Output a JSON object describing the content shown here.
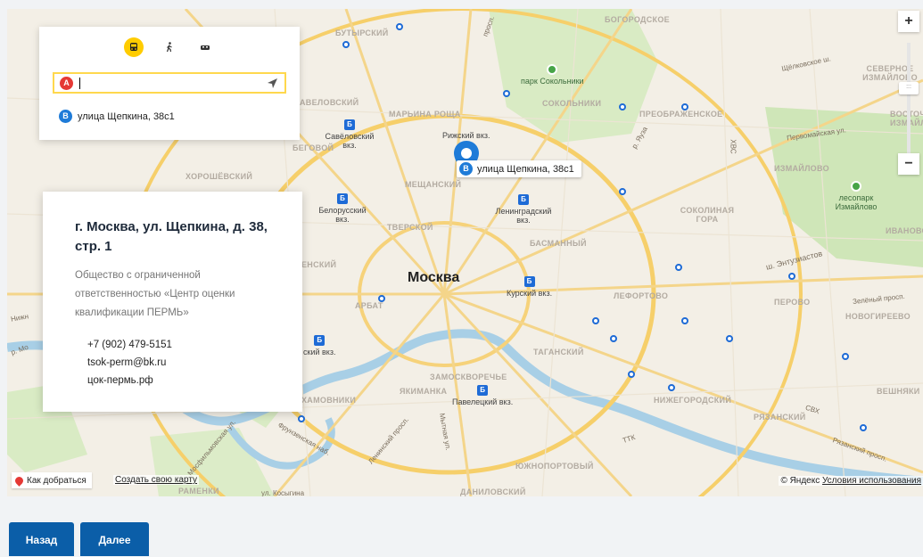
{
  "route_panel": {
    "modes": [
      "bus-icon",
      "walk-icon",
      "taxi-icon"
    ],
    "point_a": {
      "badge": "A",
      "value": ""
    },
    "point_b": {
      "badge": "B",
      "text": "улица Щепкина, 38с1"
    }
  },
  "info_card": {
    "title": "г. Москва, ул. Щепкина, д. 38, стр. 1",
    "description": "Общество с ограниченной ответственностью «Центр оценки квалификации ПЕРМЬ»",
    "phone": "+7 (902) 479-5151",
    "email": "tsok-perm@bk.ru",
    "site": "цок-пермь.рф"
  },
  "marker": {
    "badge": "B",
    "label": "улица Щепкина, 38с1"
  },
  "map": {
    "city": "Москва",
    "districts": [
      "БОГОРОДСКОЕ",
      "БУТЫРСКИЙ",
      "АВЕЛОВСКИЙ",
      "МАРЬИНА РОЩА",
      "ПРЕОБРАЖЕНСКОЕ",
      "СОКОЛЬНИКИ",
      "ХОРОШЁВСКИЙ",
      "БЕГОВОЙ",
      "МЕЩАНСКИЙ",
      "ТВЕРСКОЙ",
      "БАСМАННЫЙ",
      "ИЗМАЙЛОВО",
      "СОКОЛИНАЯ ГОРА",
      "ЛЕФОРТОВО",
      "ПЕРОВО",
      "НОВОГИРЕЕВО",
      "АРБАТ",
      "ТАГАНСКИЙ",
      "ЗАМОСКВОРЕЧЬЕ",
      "ЯКИМАНКА",
      "ХАМОВНИКИ",
      "НИЖЕГОРОДСКИЙ",
      "РЯЗАНСКИЙ",
      "ВЕШНЯКИ",
      "ЮЖНОПОРТОВЫЙ",
      "ДАНИЛОВСКИЙ",
      "РАМЕНКИ",
      "СЕВЕРНОЕ ИЗМАЙЛОВО",
      "ВОСТОЧНОЕ ИЗМАЙЛОВО",
      "ИВАНОВСКОЕ",
      "ЕНСКИЙ"
    ],
    "stations": [
      "Савёловский вкз.",
      "Рижский вкз.",
      "Белорусский вкз.",
      "Ленинградский вкз.",
      "Курский вкз.",
      "Павелецкий вкз.",
      "ский вкз."
    ],
    "parks": [
      "парк Сокольники",
      "лесопарк Измайлово"
    ],
    "roads": [
      "Щёлковское ш.",
      "Первомайская ул.",
      "ш. Энтузиастов",
      "Зелёный просп.",
      "Рязанский просп.",
      "ТТК",
      "СВХ",
      "ХВС",
      "Ленинский просп.",
      "Мытная ул.",
      "ул. Косыгина",
      "Фрунзенская наб.",
      "просп.",
      "Мосфильмовская ул.",
      "Нижн",
      "р. Мо",
      "р. Яуза"
    ],
    "howto": "Как добраться",
    "create_map": "Создать свою карту",
    "copyright_prefix": "© Яндекс",
    "terms": "Условия использования",
    "zoom_in": "+",
    "zoom_out": "−",
    "zoom_thumb": ":::"
  },
  "buttons": {
    "back": "Назад",
    "next": "Далее"
  }
}
